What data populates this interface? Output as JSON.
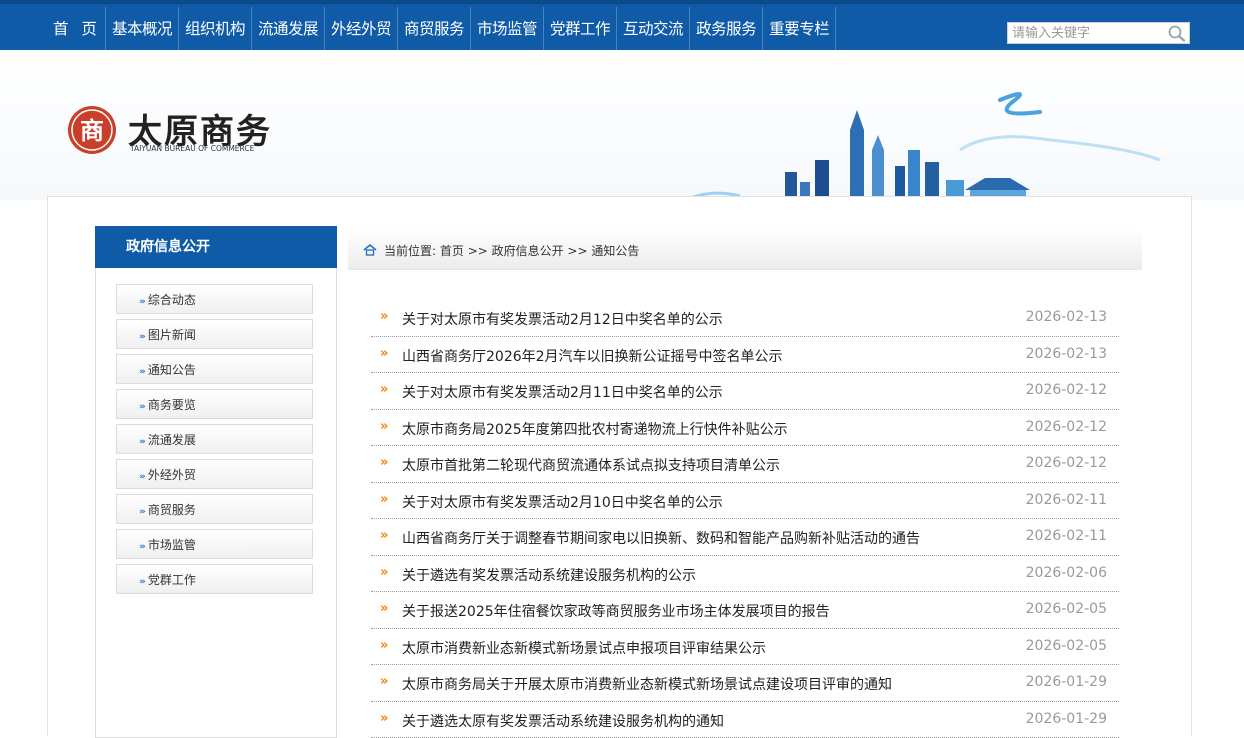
{
  "nav": {
    "items": [
      "首 页",
      "基本概况",
      "组织机构",
      "流通发展",
      "外经外贸",
      "商贸服务",
      "市场监管",
      "党群工作",
      "互动交流",
      "政务服务",
      "重要专栏"
    ],
    "search_placeholder": "请输入关键字",
    "search_icon": "search-icon"
  },
  "logo": {
    "name": "太原商务",
    "subtitle": "TAIYUAN BUREAU OF COMMERCE",
    "emblem_glyph": "商"
  },
  "sidebar": {
    "title": "政府信息公开",
    "items": [
      "综合动态",
      "图片新闻",
      "通知公告",
      "商务要览",
      "流通发展",
      "外经外贸",
      "商贸服务",
      "市场监管",
      "党群工作"
    ]
  },
  "breadcrumb": {
    "label": "当前位置:",
    "text": "首页 >> 政府信息公开 >> 通知公告"
  },
  "list": {
    "marker": "»",
    "items": [
      {
        "title": "关于对太原市有奖发票活动2月12日中奖名单的公示",
        "date": "2026-02-13"
      },
      {
        "title": "山西省商务厅2026年2月汽车以旧换新公证摇号中签名单公示",
        "date": "2026-02-13"
      },
      {
        "title": "关于对太原市有奖发票活动2月11日中奖名单的公示",
        "date": "2026-02-12"
      },
      {
        "title": "太原市商务局2025年度第四批农村寄递物流上行快件补贴公示",
        "date": "2026-02-12"
      },
      {
        "title": "太原市首批第二轮现代商贸流通体系试点拟支持项目清单公示",
        "date": "2026-02-12"
      },
      {
        "title": "关于对太原市有奖发票活动2月10日中奖名单的公示",
        "date": "2026-02-11"
      },
      {
        "title": "山西省商务厅关于调整春节期间家电以旧换新、数码和智能产品购新补贴活动的通告",
        "date": "2026-02-11"
      },
      {
        "title": "关于遴选有奖发票活动系统建设服务机构的公示",
        "date": "2026-02-06"
      },
      {
        "title": "关于报送2025年住宿餐饮家政等商贸服务业市场主体发展项目的报告",
        "date": "2026-02-05"
      },
      {
        "title": "太原市消费新业态新模式新场景试点申报项目评审结果公示",
        "date": "2026-02-05"
      },
      {
        "title": "太原市商务局关于开展太原市消费新业态新模式新场景试点建设项目评审的通知",
        "date": "2026-01-29"
      },
      {
        "title": "关于遴选太原有奖发票活动系统建设服务机构的通知",
        "date": "2026-01-29"
      }
    ]
  },
  "colors": {
    "nav_blue": "#0f5ba7",
    "marker_orange": "#ff7f00",
    "date_gray": "#9a9a9a",
    "logo_red": "#c8402a"
  }
}
